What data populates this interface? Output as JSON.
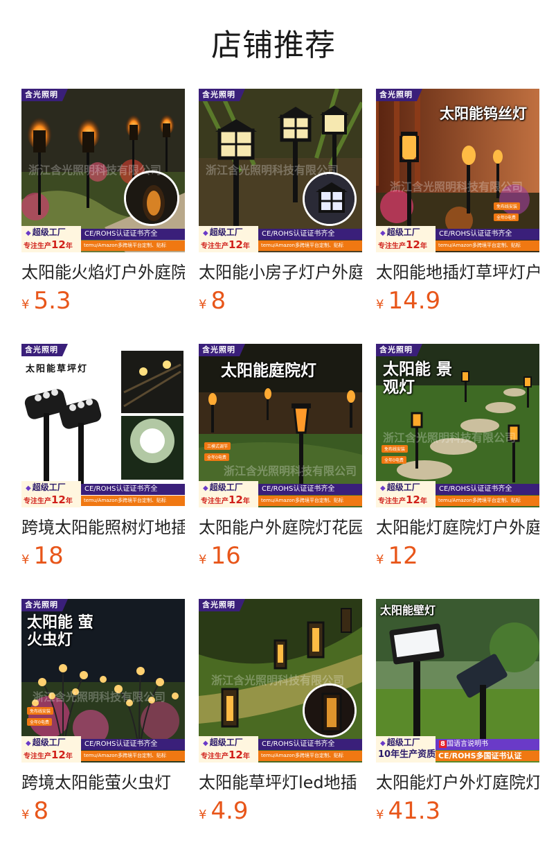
{
  "page": {
    "title": "店铺推荐"
  },
  "colors": {
    "price": "#e8561a",
    "brand_purple": "#3a1f7a",
    "accent_orange": "#f07812"
  },
  "ribbon_common": {
    "brand_badge": "含光照明",
    "super_factory": "超级工厂",
    "years_prefix": "专注生产",
    "years_number": "12",
    "years_suffix": "年",
    "cert": "CE/ROHS认证证书齐全",
    "platform": "temu/Amazon多跨境平台定制、贴标",
    "watermark": "浙江含光照明科技有限公司"
  },
  "products": [
    {
      "name": "太阳能火焰灯户外庭院",
      "currency": "¥",
      "price": "5.3",
      "overlay": "",
      "tags": []
    },
    {
      "name": "太阳能小房子灯户外庭院",
      "currency": "¥",
      "price": "8",
      "overlay": "",
      "tags": []
    },
    {
      "name": "太阳能地插灯草坪灯户",
      "currency": "¥",
      "price": "14.9",
      "overlay": "太阳能钨丝灯",
      "tags": [
        "免布线安装",
        "全年0电费"
      ]
    },
    {
      "name": "跨境太阳能照树灯地插",
      "currency": "¥",
      "price": "18",
      "overlay": "太阳能草坪灯",
      "tags": []
    },
    {
      "name": "太阳能户外庭院灯花园",
      "currency": "¥",
      "price": "16",
      "overlay": "太阳能庭院灯",
      "tags": [
        "三模式调节",
        "全年0电费"
      ]
    },
    {
      "name": "太阳能灯庭院灯户外庭",
      "currency": "¥",
      "price": "12",
      "overlay": "太阳能 景观灯",
      "tags": [
        "免布线安装",
        "全年0电费"
      ]
    },
    {
      "name": "跨境太阳能萤火虫灯",
      "currency": "¥",
      "price": "8",
      "overlay": "太阳能 萤火虫灯",
      "tags": [
        "免布线安装",
        "全年0电费"
      ]
    },
    {
      "name": "太阳能草坪灯led地插",
      "currency": "¥",
      "price": "4.9",
      "overlay": "",
      "tags": []
    },
    {
      "name": "太阳能灯户外灯庭院灯",
      "currency": "¥",
      "price": "41.3",
      "overlay": "太阳能壁灯",
      "tags": [],
      "special_ribbon": {
        "super_factory": "超级工厂",
        "years": "10年生产资质",
        "lang_number": "8",
        "lang_text": "国语言说明书",
        "cert": "CE/ROHS多国证书认证"
      }
    }
  ]
}
